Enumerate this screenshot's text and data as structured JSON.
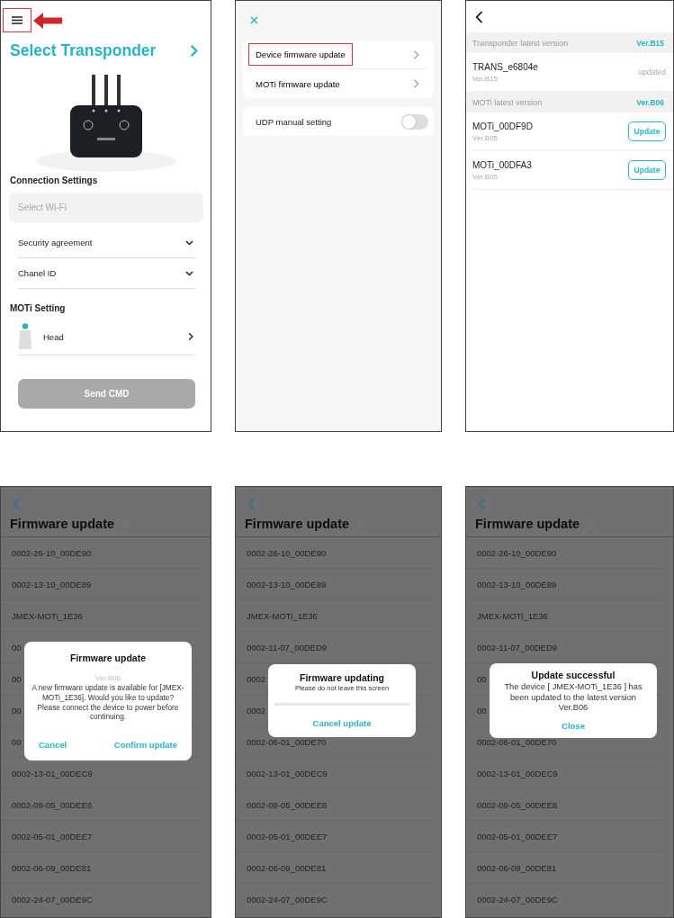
{
  "home_screen": {
    "menu_button": {
      "highlighted": true
    },
    "title": "Select Transponder",
    "connection_label": "Connection Settings",
    "wifi_field": {
      "placeholder": "Select Wi-Fi"
    },
    "dropdowns": [
      "Security agreement",
      "Chanel ID"
    ],
    "moti_label": "MOTi Setting",
    "body_parts": [
      "Head"
    ],
    "send_button": {
      "label": "Send CMD",
      "disabled": true
    }
  },
  "settings_menu": {
    "groups": [
      {
        "kind": "links",
        "items": [
          {
            "label": "Device firmware update",
            "highlighted": true
          },
          {
            "label": "MOTi firmware update",
            "highlighted": false
          }
        ]
      },
      {
        "kind": "toggles",
        "items": [
          {
            "label": "UDP manual setting",
            "on": false
          }
        ]
      }
    ]
  },
  "firmware_versions": {
    "sections": [
      {
        "title": "Transponder latest version",
        "version": "Ver.B15",
        "devices": [
          {
            "name": "TRANS_e6804e",
            "version": "Ver.B15",
            "kind": "status",
            "action": "updated"
          }
        ]
      },
      {
        "title": "MOTi latest version",
        "version": "Ver.B06",
        "devices": [
          {
            "name": "MOTi_00DF9D",
            "version": "Ver.B05",
            "kind": "button",
            "action": "Update"
          },
          {
            "name": "MOTi_00DFA3",
            "version": "Ver.B05",
            "kind": "button",
            "action": "Update"
          }
        ]
      }
    ]
  },
  "update_screens": [
    {
      "title": "Firmware update",
      "rows": [
        "0002-26-10_00DE90",
        "0002-13-10_00DE89",
        "JMEX-MOTi_1E36",
        "00",
        "00",
        "00",
        "00",
        "0002-13-01_00DEC9",
        "0002-09-05_00DEE6",
        "0002-05-01_00DEE7",
        "0002-06-09_00DE81",
        "0002-24-07_00DE9C"
      ],
      "dialog": {
        "kind": "confirm",
        "title": "Firmware update",
        "version": "Ver.B06",
        "message": "A new firmware update is available for [JMEX-MOTi_1E36]. Would you like to update? Please connect the device to power before continuing.",
        "buttons": [
          "Cancel",
          "Confirm update"
        ]
      }
    },
    {
      "title": "Firmware update",
      "rows": [
        "0002-26-10_00DE90",
        "0002-13-10_00DE89",
        "JMEX-MOTi_1E36",
        "0002-11-07_00DED9",
        "0002",
        "0002",
        "0002-06-01_00DE70",
        "0002-13-01_00DEC9",
        "0002-09-05_00DEE6",
        "0002-05-01_00DEE7",
        "0002-06-09_00DE81",
        "0002-24-07_00DE9C"
      ],
      "dialog": {
        "kind": "progress",
        "title": "Firmware updating",
        "message": "Please do not leave this screen",
        "level": 0,
        "buttons": [
          "Cancel update"
        ]
      }
    },
    {
      "title": "Firmware update",
      "rows": [
        "0002-26-10_00DE90",
        "0002-13-10_00DE89",
        "JMEX-MOTi_1E36",
        "0002-11-07_00DED9",
        "00",
        "00",
        "0002-06-01_00DE70",
        "0002-13-01_00DEC9",
        "0002-09-05_00DEE6",
        "0002-05-01_00DEE7",
        "0002-06-09_00DE81",
        "0002-24-07_00DE9C"
      ],
      "dialog": {
        "kind": "result",
        "title": "Update successful",
        "message": "The device [ JMEX-MOTi_1E36 ] has\nbeen updated to the latest version\nVer.B06",
        "buttons": [
          "Close"
        ]
      }
    }
  ]
}
